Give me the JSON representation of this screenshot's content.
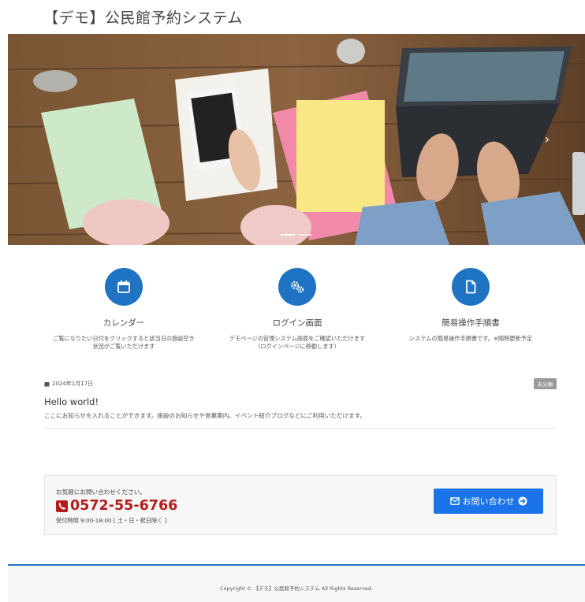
{
  "site": {
    "title": "【デモ】公民館予約システム"
  },
  "hero": {
    "next_label": "›",
    "slides": 2
  },
  "features": [
    {
      "icon": "calendar-icon",
      "title": "カレンダー",
      "desc_line1": "ご覧になりたい日付をクリックすると該当日の施設空き",
      "desc_line2": "状況がご覧いただけます"
    },
    {
      "icon": "gears-icon",
      "title": "ログイン画面",
      "desc_line1": "デモページの管理システム画面をご確認いただけます",
      "desc_line2": "（ログインページに移動します）"
    },
    {
      "icon": "document-icon",
      "title": "簡易操作手順書",
      "desc_line1": "システムの簡易操作手順書です。※随時更新予定",
      "desc_line2": ""
    }
  ],
  "news": {
    "date": "2024年1月17日",
    "category": "未分類",
    "title": "Hello world!",
    "body": "ここにお知らせを入れることができます。施設のお知らせや営業案内、イベント紹介ブログなどにご利用いただけます。"
  },
  "contact": {
    "lead": "お気軽にお問い合わせください。",
    "phone": "0572-55-6766",
    "hours": "受付時間 9:00-18:00 [ 土・日・祝日除く ]",
    "button_label": "お問い合わせ"
  },
  "footer": {
    "copyright": "Copyright © 【デモ】公民館予約システム All Rights Reserved."
  },
  "colors": {
    "accent": "#1f73c3",
    "button": "#1a73e8",
    "phone": "#b71c1c"
  }
}
